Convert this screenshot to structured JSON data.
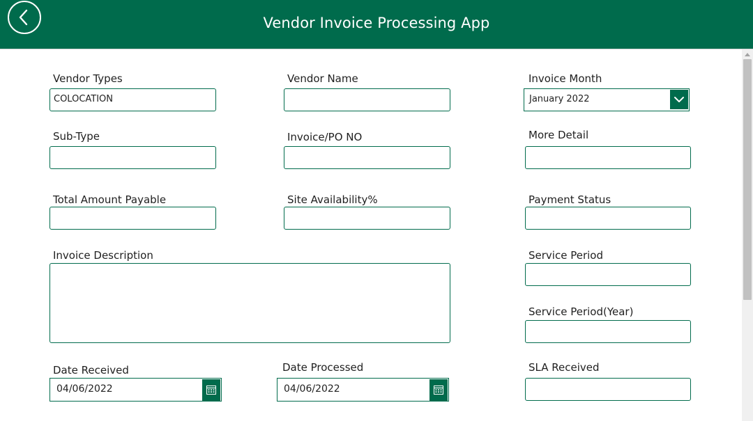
{
  "header": {
    "title": "Vendor Invoice Processing App",
    "back_icon": "chevron-left-icon",
    "background_color": "#006b4c"
  },
  "form": {
    "vendor_types": {
      "label": "Vendor Types",
      "value": "COLOCATION"
    },
    "vendor_name": {
      "label": "Vendor Name",
      "value": ""
    },
    "invoice_month": {
      "label": "Invoice Month",
      "value": "January 2022",
      "icon": "chevron-down-icon"
    },
    "sub_type": {
      "label": "Sub-Type",
      "value": ""
    },
    "invoice_po_no": {
      "label": "Invoice/PO NO",
      "value": ""
    },
    "more_detail": {
      "label": "More Detail",
      "value": ""
    },
    "total_amount_payable": {
      "label": "Total Amount Payable",
      "value": ""
    },
    "site_availability": {
      "label": "Site Availability%",
      "value": ""
    },
    "payment_status": {
      "label": "Payment Status",
      "value": ""
    },
    "invoice_description": {
      "label": "Invoice Description",
      "value": ""
    },
    "service_period": {
      "label": "Service Period",
      "value": ""
    },
    "service_period_year": {
      "label": "Service Period(Year)",
      "value": ""
    },
    "date_received": {
      "label": "Date Received",
      "value": "04/06/2022",
      "icon": "calendar-icon"
    },
    "date_processed": {
      "label": "Date Processed",
      "value": "04/06/2022",
      "icon": "calendar-icon"
    },
    "sla_received": {
      "label": "SLA Received",
      "value": ""
    }
  },
  "colors": {
    "accent": "#006b4c",
    "scrollbar_track": "#f0f0f0",
    "scrollbar_thumb": "#c1c1c1"
  }
}
